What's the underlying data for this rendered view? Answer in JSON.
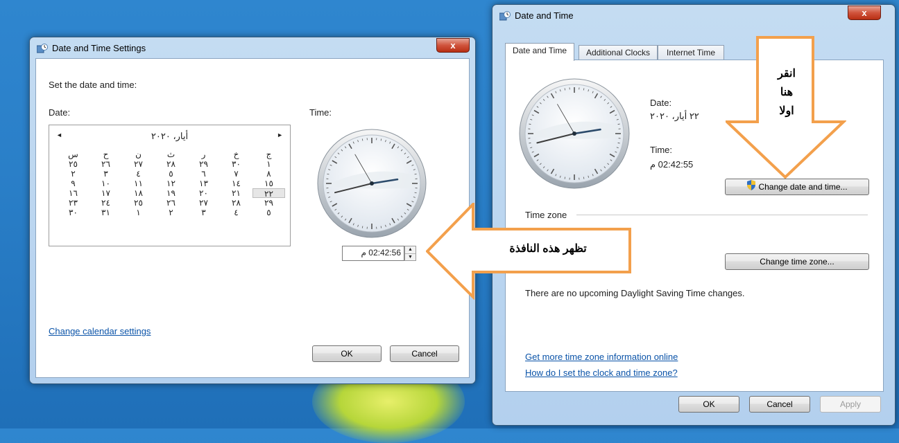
{
  "left_window": {
    "title": "Date and Time Settings",
    "close_label": "x",
    "set_prompt": "Set the date and time:",
    "date_label": "Date:",
    "time_label": "Time:",
    "calendar": {
      "month_title": "أيار، ٢٠٢٠",
      "prev_arrow": "◄",
      "next_arrow": "►",
      "weekdays": [
        "ج",
        "خ",
        "ر",
        "ث",
        "ن",
        "ح",
        "س"
      ],
      "weeks": [
        [
          "١",
          "٣٠",
          "٢٩",
          "٢٨",
          "٢٧",
          "٢٦",
          "٢٥"
        ],
        [
          "٨",
          "٧",
          "٦",
          "٥",
          "٤",
          "٣",
          "٢"
        ],
        [
          "١٥",
          "١٤",
          "١٣",
          "١٢",
          "١١",
          "١٠",
          "٩"
        ],
        [
          "٢٢",
          "٢١",
          "٢٠",
          "١٩",
          "١٨",
          "١٧",
          "١٦"
        ],
        [
          "٢٩",
          "٢٨",
          "٢٧",
          "٢٦",
          "٢٥",
          "٢٤",
          "٢٣"
        ],
        [
          "٥",
          "٤",
          "٣",
          "٢",
          "١",
          "٣١",
          "٣٠"
        ]
      ],
      "selected": "٢٢"
    },
    "time_value": "02:42:56 م",
    "change_calendar_link": "Change calendar settings",
    "ok_label": "OK",
    "cancel_label": "Cancel"
  },
  "right_window": {
    "title": "Date and Time",
    "close_label": "x",
    "tabs": [
      "Date and Time",
      "Additional Clocks",
      "Internet Time"
    ],
    "date_label": "Date:",
    "date_value": "٢٢ أيار، ٢٠٢٠",
    "time_label": "Time:",
    "time_value": "02:42:55 م",
    "change_datetime_label": "Change date and time...",
    "timezone_header": "Time zone",
    "change_timezone_label": "Change time zone...",
    "dst_message": "There are no upcoming Daylight Saving Time changes.",
    "link_more_info": "Get more time zone information online",
    "link_how_set": "How do I set the clock and time zone?",
    "ok_label": "OK",
    "cancel_label": "Cancel",
    "apply_label": "Apply"
  },
  "annotations": {
    "down_arrow_text": [
      "انقر",
      "هنا",
      "اولا"
    ],
    "left_arrow_text": "تظهر هذه النافذة",
    "arrow_color": "#f3a04c"
  }
}
